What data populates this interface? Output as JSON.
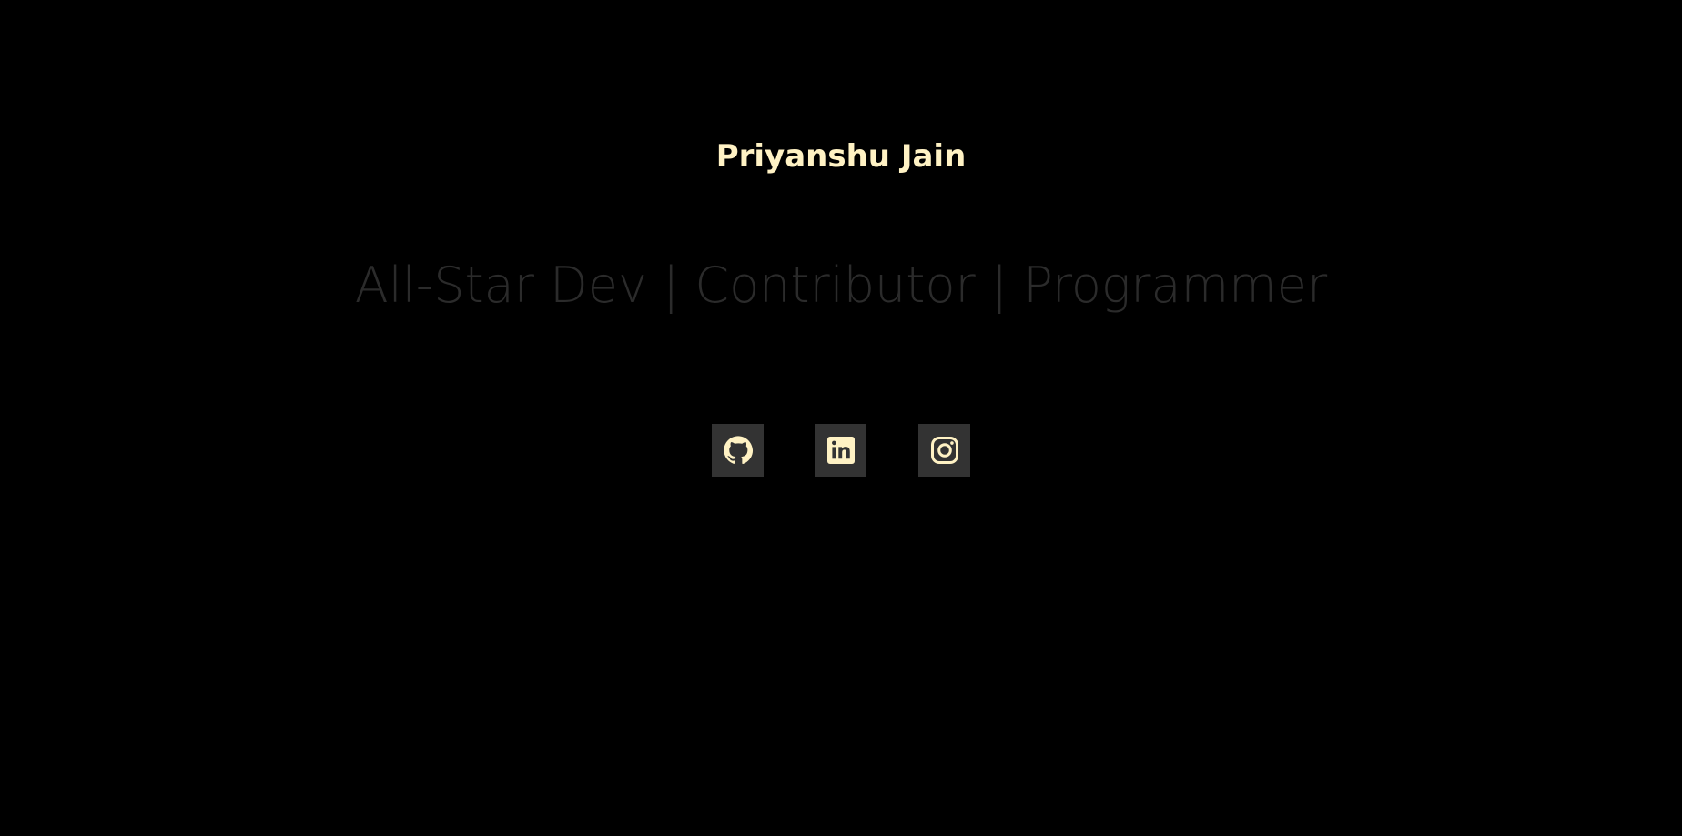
{
  "header": {
    "name": "Priyanshu Jain",
    "tagline": "All-Star Dev | Contributor | Programmer"
  },
  "socials": [
    {
      "icon": "github-icon"
    },
    {
      "icon": "linkedin-icon"
    },
    {
      "icon": "instagram-icon"
    }
  ],
  "colors": {
    "background": "#000000",
    "name_text": "#fff2c4",
    "tagline_text": "#2b2b2b",
    "icon_bg": "#333333",
    "icon_fg": "#fff2c4"
  }
}
